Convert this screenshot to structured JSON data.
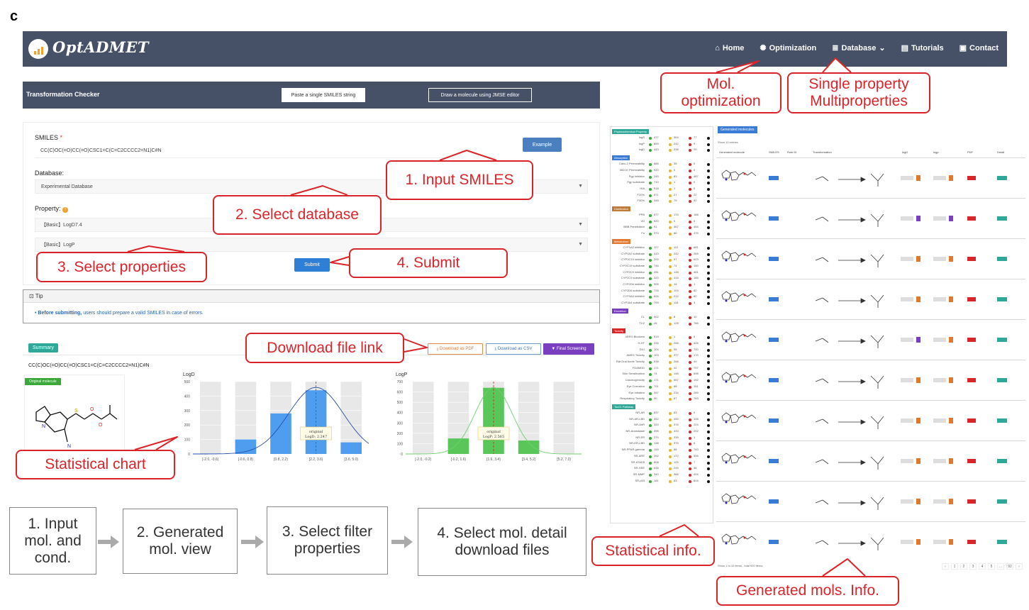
{
  "panel_label": "c",
  "navbar": {
    "logo": "OptADMET",
    "items": [
      {
        "label": "Home",
        "icon": "home-icon",
        "glyph": "⌂"
      },
      {
        "label": "Optimization",
        "icon": "cog-icon",
        "glyph": "✺"
      },
      {
        "label": "Database",
        "icon": "database-icon",
        "glyph": "≣",
        "caret": "⌄"
      },
      {
        "label": "Tutorials",
        "icon": "document-icon",
        "glyph": "▤"
      },
      {
        "label": "Contact",
        "icon": "contact-card-icon",
        "glyph": "▣"
      }
    ]
  },
  "checker": {
    "title": "Transformation Checker",
    "paste_button": "Paste a single SMILES string",
    "draw_button": "Draw a molecule using JMSE editor"
  },
  "form": {
    "smiles_label": "SMILES",
    "smiles_required": "*",
    "smiles_value": "CC(C)OC(=O)CC(=O)CSC1=C(C=C2CCCC2=N1)C#N",
    "example_button": "Example",
    "database_label": "Database:",
    "database_value": "Experimental Database",
    "property_label": "Property:",
    "property_1": "【Basic】LogD7.4",
    "property_2": "【Basic】LogP",
    "submit_button": "Submit"
  },
  "tip": {
    "title": "Tip",
    "bold": "Before submitting,",
    "text": " users should prepare a valid SMILES in case of errors."
  },
  "summary": {
    "badge": "Summary",
    "download_pdf": "Download as PDF",
    "download_csv": "Download as CSV",
    "final_screening": "Final Screening",
    "smiles": "CC(C)OC(=O)CC(=O)CSC1=C(C=C2CCCC2=N1)C#N",
    "original_badge": "Original molecule"
  },
  "chart_data": [
    {
      "type": "bar",
      "ylabel": "LogD",
      "ylim": [
        0,
        500
      ],
      "yticks": [
        "500",
        "400",
        "300",
        "200",
        "100",
        "0"
      ],
      "categories": [
        "[-2.0, -0.6)",
        "[-0.6, 0.8)",
        "[0.8, 2.2)",
        "[2.2, 3.6)",
        "[3.6, 5.0)"
      ],
      "values": [
        3,
        100,
        280,
        440,
        80
      ],
      "annotation": [
        "original",
        "LogD: 2.247"
      ],
      "bar_color": "#3d95f0"
    },
    {
      "type": "bar",
      "ylabel": "LogP",
      "ylim": [
        0,
        700
      ],
      "yticks": [
        "700",
        "600",
        "500",
        "400",
        "300",
        "200",
        "100",
        "0"
      ],
      "categories": [
        "[-2.0, -0.2)",
        "[-0.2, 1.6)",
        "[1.6, 3.4)",
        "[3.4, 5.2)",
        "[5.2, 7.0)"
      ],
      "values": [
        3,
        150,
        640,
        130,
        3
      ],
      "annotation": [
        "original",
        "LogP: 2.565"
      ],
      "bar_color": "#49c24a"
    }
  ],
  "callouts": {
    "mol_opt": [
      "Mol.",
      "optimization"
    ],
    "single_multi": [
      "Single property",
      "Multiproperties"
    ],
    "input_smiles": "1. Input SMILES",
    "select_db": "2. Select database",
    "select_props": "3. Select properties",
    "submit": "4. Submit",
    "download_link": "Download file link",
    "stat_chart": "Statistical chart",
    "stat_info": "Statistical info.",
    "gen_info": "Generated mols. Info."
  },
  "flow": [
    [
      "1. Input",
      "mol. and",
      "cond."
    ],
    [
      "2. Generated",
      "mol. view"
    ],
    [
      "3. Select filter",
      "properties"
    ],
    [
      "4. Select mol. detail",
      "download files"
    ]
  ],
  "stat_panel": {
    "categories": [
      {
        "name": "Physicochemical Property",
        "color": "#2fa89a",
        "rows": [
          [
            "logS",
            "477",
            "364",
            "77"
          ],
          [
            "logP",
            "859",
            "242",
            "9"
          ],
          [
            "logD",
            "443",
            "338",
            "29"
          ]
        ]
      },
      {
        "name": "Absorption",
        "color": "#3a7bd5",
        "rows": [
          [
            "Caco-2 Permeability",
            "885",
            "35",
            "0"
          ],
          [
            "MDCK Permeability",
            "920",
            "0",
            "0"
          ],
          [
            "Pgp inhibitor",
            "245",
            "83",
            "487"
          ],
          [
            "Pgp substrate",
            "710",
            "1",
            "0"
          ],
          [
            "HIA",
            "918",
            "1",
            "0"
          ],
          [
            "F20%",
            "871",
            "27",
            "22"
          ],
          [
            "F30%",
            "348",
            "79",
            "92"
          ]
        ]
      },
      {
        "name": "Distribution",
        "color": "#c07a3a",
        "rows": [
          [
            "PPB",
            "577",
            "175",
            "168"
          ],
          [
            "VD",
            "920",
            "0",
            "0"
          ],
          [
            "BBB Penetration",
            "91",
            "367",
            "464"
          ],
          [
            "Fu",
            "379",
            "66",
            "475"
          ]
        ]
      },
      {
        "name": "Metabolism",
        "color": "#e0782d",
        "rows": [
          [
            "CYP1A2 inhibitor",
            "127",
            "112",
            "681"
          ],
          [
            "CYP1A2 substrate",
            "413",
            "242",
            "265"
          ],
          [
            "CYP2C19 inhibitor",
            "200",
            "97",
            "623"
          ],
          [
            "CYP2C19 substrate",
            "746",
            "74",
            "100"
          ],
          [
            "CYP2C9 inhibitor",
            "281",
            "138",
            "481"
          ],
          [
            "CYP2C9 substrate",
            "320",
            "415",
            "185"
          ],
          [
            "CYP2D6 inhibitor",
            "905",
            "14",
            "1"
          ],
          [
            "CYP2D6 substrate",
            "725",
            "103",
            "82"
          ],
          [
            "CYP3A4 inhibitor",
            "626",
            "212",
            "82"
          ],
          [
            "CYP3A4 substrate",
            "799",
            "118",
            "3"
          ]
        ]
      },
      {
        "name": "Excretion",
        "color": "#7a3fc0",
        "rows": [
          [
            "CL",
            "902",
            "8",
            "10"
          ],
          [
            "T1/2",
            "26",
            "128",
            "766"
          ]
        ]
      },
      {
        "name": "Toxicity",
        "color": "#d9252a",
        "rows": [
          [
            "hERG Blockers",
            "919",
            "1",
            "0"
          ],
          [
            "H-HT",
            "226",
            "268",
            "426"
          ],
          [
            "DILI",
            "104",
            "95",
            "720"
          ],
          [
            "AMES Toxicity",
            "103",
            "377",
            "170"
          ],
          [
            "Rat Oral Acute Toxicity",
            "638",
            "268",
            "40"
          ],
          [
            "FDAMDD",
            "171",
            "42",
            "707"
          ],
          [
            "Skin Sensitization",
            "74",
            "148",
            "698"
          ],
          [
            "Carcinogenicity",
            "171",
            "557",
            "192"
          ],
          [
            "Eye Corrosion",
            "701",
            "68",
            "151"
          ],
          [
            "Eye Irritation",
            "397",
            "234",
            "289"
          ],
          [
            "Respiratory Toxicity",
            "90",
            "67",
            "763"
          ]
        ]
      },
      {
        "name": "Tox21 Pathway",
        "color": "#2fa89a",
        "rows": [
          [
            "NR-AR",
            "837",
            "83",
            "0"
          ],
          [
            "NR-AR-LBD",
            "452",
            "400",
            "108"
          ],
          [
            "NR-AhR",
            "320",
            "376",
            "224"
          ],
          [
            "NR-Aromatase",
            "395",
            "333",
            "202"
          ],
          [
            "NR-ER",
            "274",
            "339",
            "1"
          ],
          [
            "NR-ER-LBD",
            "138",
            "376",
            "6"
          ],
          [
            "NR-PPAR-gamma",
            "159",
            "88",
            "743"
          ],
          [
            "SR-ARE",
            "192",
            "172",
            "506"
          ],
          [
            "SR-ATAD5",
            "808",
            "105",
            "7"
          ],
          [
            "SR-HSE",
            "635",
            "249",
            "36"
          ],
          [
            "SR-MMP",
            "340",
            "366",
            "404"
          ],
          [
            "SR-p53",
            "181",
            "83",
            "604"
          ]
        ]
      }
    ]
  },
  "gen_panel": {
    "badge": "Generated molecules",
    "show": "Show  10  entries",
    "columns": [
      "Generated molecule",
      "SMILES",
      "Rule ID",
      "Transformation",
      "logD",
      "logp",
      "PDF",
      "Detail"
    ],
    "footer": "Show 1 to 10 items , total 920 items",
    "pager": [
      "‹",
      "1",
      "2",
      "3",
      "4",
      "5",
      "…",
      "92",
      "›"
    ]
  }
}
